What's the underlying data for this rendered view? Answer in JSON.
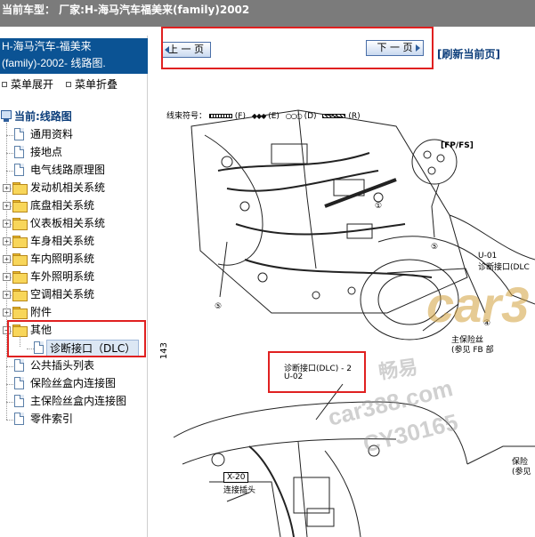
{
  "topbar": {
    "text": "当前车型：  厂家:H-海马汽车福美来(family)2002"
  },
  "sidebar": {
    "title_line1": "H-海马汽车-福美来",
    "title_line2": "(family)-2002- 线路图.",
    "expand_label": "菜单展开",
    "collapse_label": "菜单折叠",
    "root_label": "当前:线路图",
    "items": [
      {
        "label": "通用资料",
        "type": "doc"
      },
      {
        "label": "接地点",
        "type": "doc"
      },
      {
        "label": "电气线路原理图",
        "type": "doc"
      },
      {
        "label": "发动机相关系统",
        "type": "folder"
      },
      {
        "label": "底盘相关系统",
        "type": "folder"
      },
      {
        "label": "仪表板相关系统",
        "type": "folder"
      },
      {
        "label": "车身相关系统",
        "type": "folder"
      },
      {
        "label": "车内照明系统",
        "type": "folder"
      },
      {
        "label": "车外照明系统",
        "type": "folder"
      },
      {
        "label": "空调相关系统",
        "type": "folder"
      },
      {
        "label": "附件",
        "type": "folder"
      },
      {
        "label": "其他",
        "type": "folder-open"
      },
      {
        "label": "诊断接口（DLC）",
        "type": "doc-child"
      },
      {
        "label": "公共插头列表",
        "type": "doc"
      },
      {
        "label": "保险丝盒内连接图",
        "type": "doc"
      },
      {
        "label": "主保险丝盒内连接图",
        "type": "doc"
      },
      {
        "label": "零件索引",
        "type": "doc"
      }
    ]
  },
  "content": {
    "prev_label": "上 一 页",
    "next_label": "下 一 页",
    "refresh_label": "[刷新当前页]",
    "legend": "线束符号：",
    "legend_items": [
      "(F)",
      "(E)",
      "(D)",
      "(R)"
    ],
    "page_number": "143",
    "fp_fs": "[FP/FS]",
    "u01": "U-01",
    "u01_label": "诊断接口(DLC",
    "main_fuse": "主保险丝",
    "main_fuse_ref": "(参见 FB 部",
    "dlc2_line1": "诊断接口(DLC) - 2",
    "dlc2_line2": "U-02",
    "x20": "X-20",
    "x20_label": "连接插头",
    "fuse_right": "保险",
    "fuse_right_ref": "(参见",
    "callout_1": "①",
    "callout_4": "④",
    "callout_5": "⑤",
    "watermark_logo": "car3",
    "watermark_cn": "畅易",
    "watermark_url": "car388.com",
    "watermark_code": "CY30165"
  },
  "colors": {
    "topbar": "#7b7b7b",
    "sidebar_title": "#0b5394",
    "highlight": "#e02020"
  }
}
